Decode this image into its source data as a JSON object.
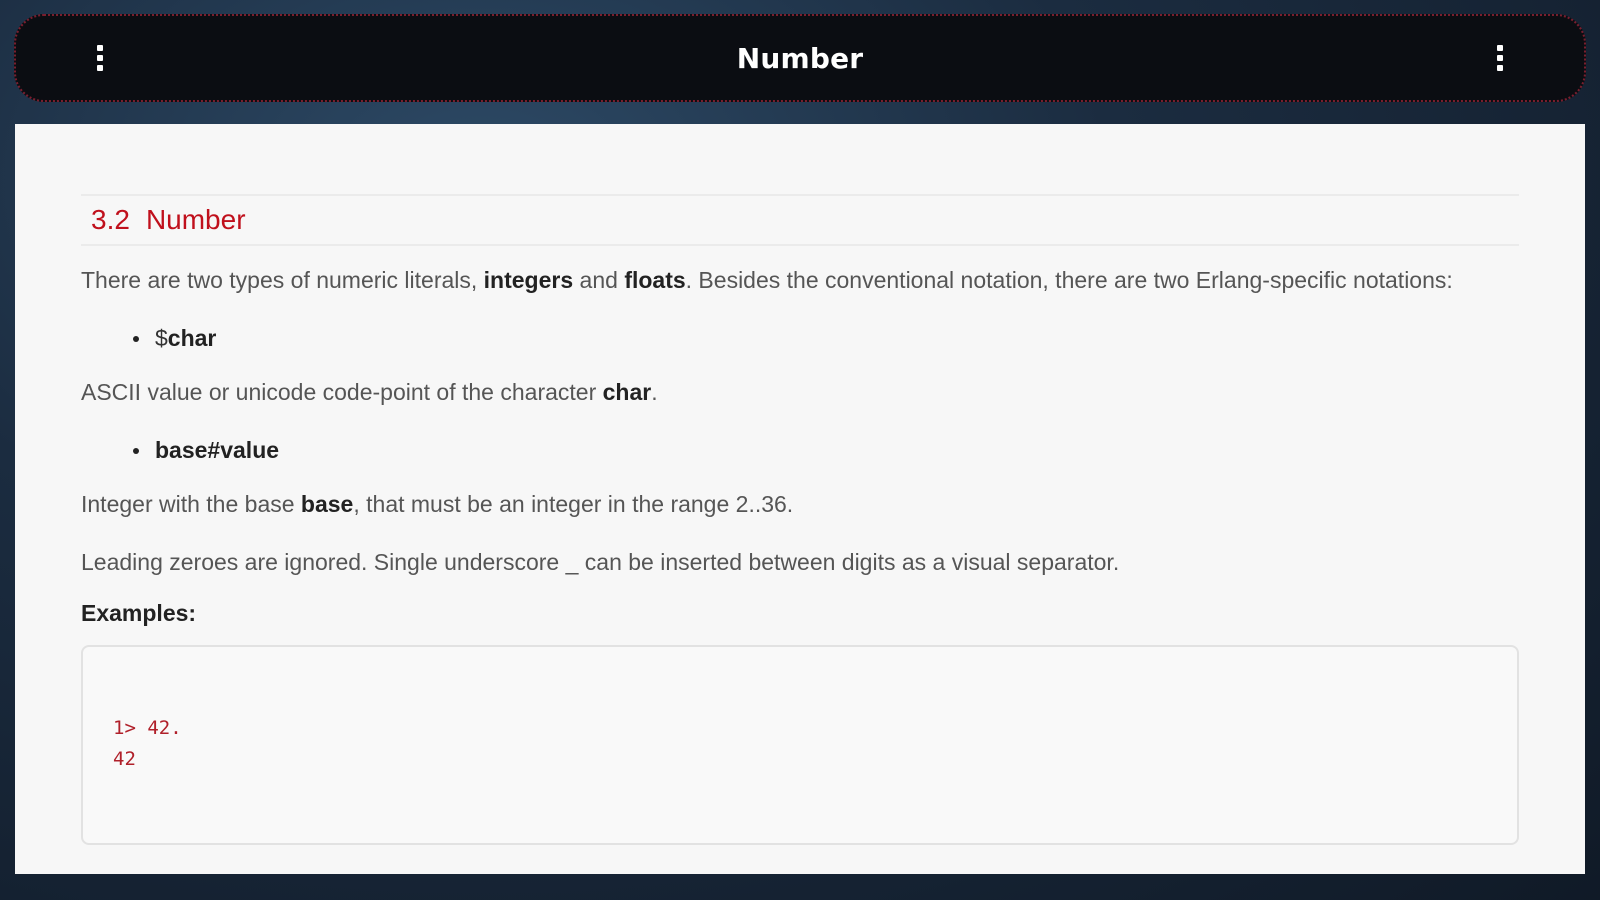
{
  "app": {
    "title": "Number"
  },
  "section": {
    "number": "3.2",
    "title": "Number"
  },
  "intro": {
    "text1": "There are two types of numeric literals, ",
    "bold1": "integers",
    "text2": " and ",
    "bold2": "floats",
    "text3": ". Besides the conventional notation, there are two Erlang-specific notations:"
  },
  "notation_char": {
    "prefix": "$",
    "bold": "char",
    "desc_text": "ASCII value or unicode code-point of the character ",
    "desc_bold": "char",
    "desc_end": "."
  },
  "notation_base": {
    "bold": "base#value",
    "desc_text": "Integer with the base ",
    "desc_bold": "base",
    "desc_end": ", that must be an integer in the range 2..36."
  },
  "separator_note": "Leading zeroes are ignored. Single underscore _ can be inserted between digits as a visual separator.",
  "examples_label": "Examples:",
  "code_lines": [
    "1> 42.",
    "42"
  ],
  "colors": {
    "accent": "#c0101c",
    "topbar": "#0b0d12",
    "code": "#b0202a"
  }
}
